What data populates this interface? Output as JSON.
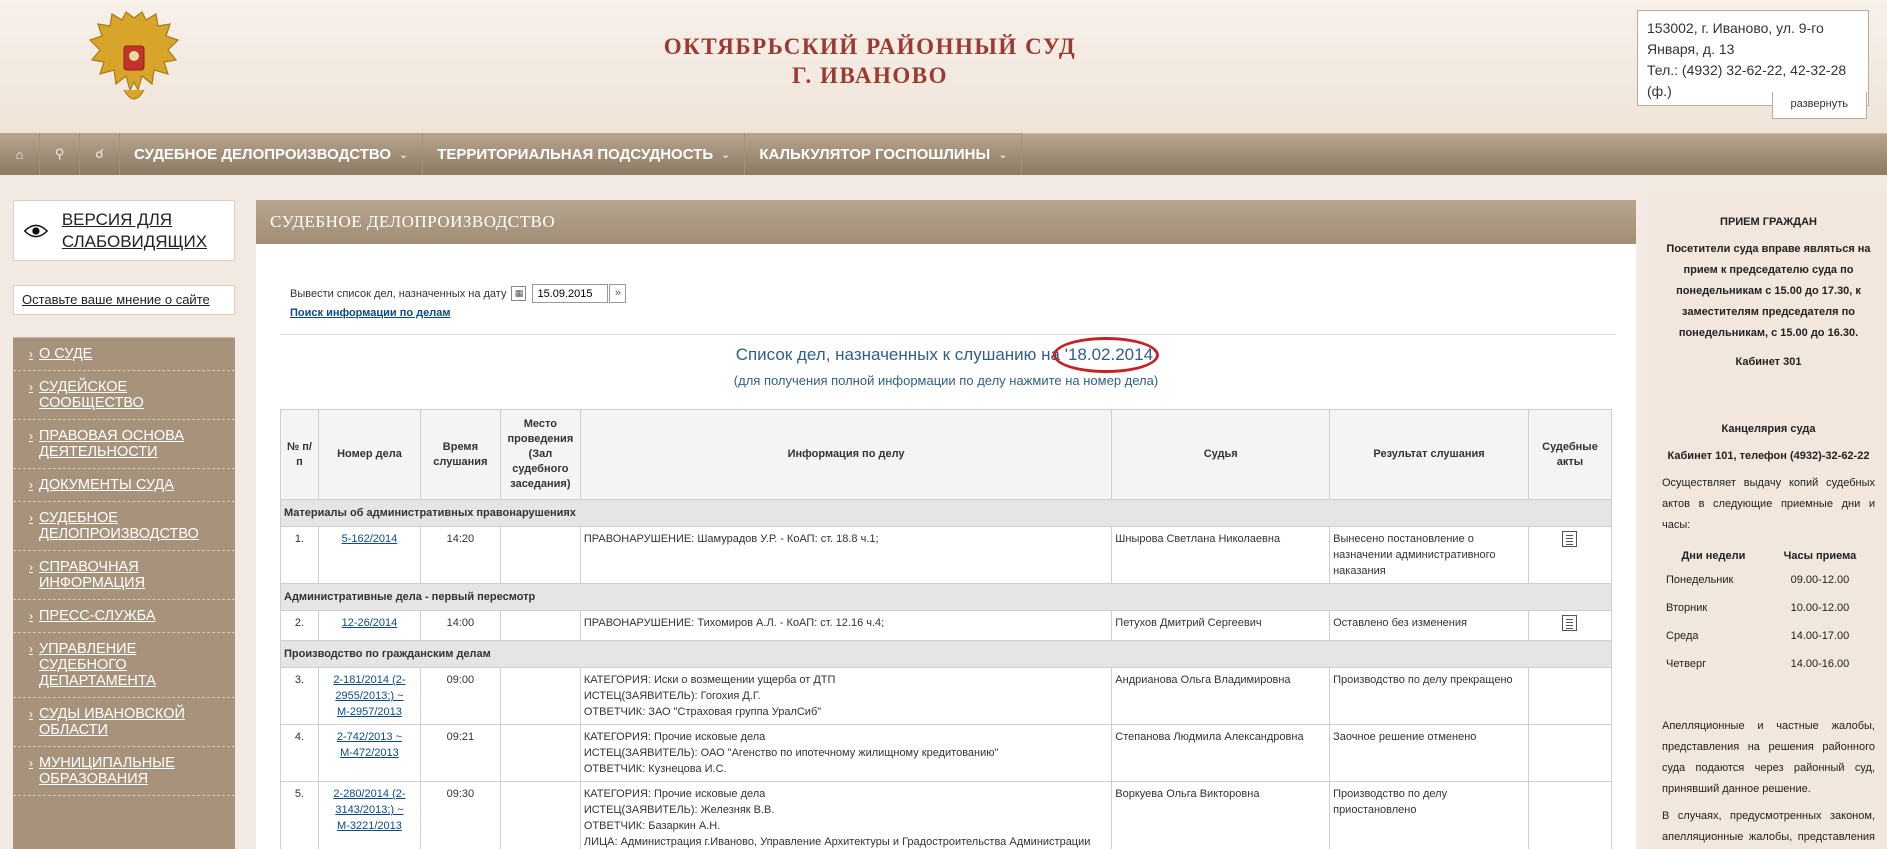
{
  "header": {
    "title_line1": "ОКТЯБРЬСКИЙ РАЙОННЫЙ СУД",
    "title_line2": "Г. ИВАНОВО",
    "address": "153002, г. Иваново, ул. 9-го Января, д. 13",
    "phone": "Тел.: (4932) 32-62-22, 42-32-28 (ф.)",
    "expand_label": "развернуть"
  },
  "nav": {
    "items": [
      {
        "label": "СУДЕБНОЕ ДЕЛОПРОИЗВОДСТВО"
      },
      {
        "label": "ТЕРРИТОРИАЛЬНАЯ ПОДСУДНОСТЬ"
      },
      {
        "label": "КАЛЬКУЛЯТОР ГОСПОШЛИНЫ"
      }
    ]
  },
  "left": {
    "vision_label": "ВЕРСИЯ ДЛЯ СЛАБОВИДЯЩИХ",
    "opinion_label": "Оставьте ваше мнение о сайте",
    "menu": [
      "О СУДЕ",
      "СУДЕЙСКОЕ СООБЩЕСТВО",
      "ПРАВОВАЯ ОСНОВА ДЕЯТЕЛЬНОСТИ",
      "ДОКУМЕНТЫ СУДА",
      "СУДЕБНОЕ ДЕЛОПРОИЗВОДСТВО",
      "СПРАВОЧНАЯ ИНФОРМАЦИЯ",
      "ПРЕСС-СЛУЖБА",
      "УПРАВЛЕНИЕ СУДЕБНОГО ДЕПАРТАМЕНТА",
      "СУДЫ ИВАНОВСКОЙ ОБЛАСТИ",
      "МУНИЦИПАЛЬНЫЕ ОБРАЗОВАНИЯ"
    ]
  },
  "main": {
    "section_title": "СУДЕБНОЕ ДЕЛОПРОИЗВОДСТВО",
    "date_label": "Вывести список дел, назначенных на дату",
    "date_value": "15.09.2015",
    "search_link": "Поиск информации по делам",
    "list_title": "Список дел, назначенных к слушанию на",
    "list_date": "'18.02.2014'",
    "list_subtitle": "(для получения полной информации по делу нажмите на номер дела)",
    "columns": [
      "№ п/п",
      "Номер дела",
      "Время слушания",
      "Место проведения (Зал судебного заседания)",
      "Информация по делу",
      "Судья",
      "Результат слушания",
      "Судебные акты"
    ],
    "groups": [
      {
        "name": "Материалы об административных правонарушениях",
        "rows": [
          {
            "n": "1.",
            "case": "5-162/2014",
            "time": "14:20",
            "place": "",
            "info": [
              "ПРАВОНАРУШЕНИЕ: Шамурадов У.Р. - КоАП: ст. 18.8 ч.1;"
            ],
            "judge": "Шнырова Светлана Николаевна",
            "result": "Вынесено постановление о назначении административного наказания",
            "acts": true
          }
        ]
      },
      {
        "name": "Административные дела - первый пересмотр",
        "rows": [
          {
            "n": "2.",
            "case": "12-26/2014",
            "time": "14:00",
            "place": "",
            "info": [
              "ПРАВОНАРУШЕНИЕ: Тихомиров А.Л. - КоАП: ст. 12.16 ч.4;"
            ],
            "judge": "Петухов Дмитрий Сергеевич",
            "result": "Оставлено без изменения",
            "acts": true
          }
        ]
      },
      {
        "name": "Производство по гражданским делам",
        "rows": [
          {
            "n": "3.",
            "case": "2-181/2014 (2-2955/2013;) ~ М-2957/2013",
            "time": "09:00",
            "place": "",
            "info": [
              "КАТЕГОРИЯ: Иски о возмещении ущерба от ДТП",
              "ИСТЕЦ(ЗАЯВИТЕЛЬ): Гогохия Д.Г.",
              "ОТВЕТЧИК: ЗАО \"Страховая группа УралСиб\""
            ],
            "judge": "Андрианова Ольга Владимировна",
            "result": "Производство по делу прекращено",
            "acts": false
          },
          {
            "n": "4.",
            "case": "2-742/2013 ~ М-472/2013",
            "time": "09:21",
            "place": "",
            "info": [
              "КАТЕГОРИЯ: Прочие исковые дела",
              "ИСТЕЦ(ЗАЯВИТЕЛЬ): ОАО \"Агенство по ипотечному жилищному кредитованию\"",
              "ОТВЕТЧИК: Кузнецова И.С."
            ],
            "judge": "Степанова Людмила Александровна",
            "result": "Заочное решение отменено",
            "acts": false
          },
          {
            "n": "5.",
            "case": "2-280/2014 (2-3143/2013;) ~ М-3221/2013",
            "time": "09:30",
            "place": "",
            "info": [
              "КАТЕГОРИЯ: Прочие исковые дела",
              "ИСТЕЦ(ЗАЯВИТЕЛЬ): Железняк В.В.",
              "ОТВЕТЧИК: Базаркин А.Н.",
              "ЛИЦА: Администрация г.Иваново, Управление Архитектуры и Градостроительства Администрации г.Иваново"
            ],
            "judge": "Воркуева Ольга Викторовна",
            "result": "Производство по делу приостановлено",
            "acts": false
          }
        ]
      }
    ]
  },
  "right": {
    "reception_title": "ПРИЕМ ГРАЖДАН",
    "reception_text": "Посетители суда вправе являться на прием к председателю суда по понедельникам с 15.00 до 17.30, к заместителям председателя по понедельникам, с 15.00 до 16.30.",
    "cabinet": "Кабинет 301",
    "office_title": "Канцелярия суда",
    "office_cabinet": "Кабинет 101, телефон (4932)-32-62-22",
    "office_text": "Осуществляет выдачу копий судебных актов в следующие приемные дни и часы:",
    "hours_head_day": "Дни недели",
    "hours_head_time": "Часы приема",
    "hours": [
      {
        "day": "Понедельник",
        "time": "09.00-12.00"
      },
      {
        "day": "Вторник",
        "time": "10.00-12.00"
      },
      {
        "day": "Среда",
        "time": "14.00-17.00"
      },
      {
        "day": "Четверг",
        "time": "14.00-16.00"
      }
    ],
    "appeal_text": "Апелляционные и частные жалобы, представления на решения районного суда подаются через районный суд, принявший данное решение.",
    "appeal_text2": "В случаях, предусмотренных законом, апелляционные жалобы, представления и приложения к ним письменные"
  },
  "colors": {
    "accent": "#9a3b33",
    "nav": "#a28d75",
    "link": "#0b4a8b",
    "highlight": "#c42224"
  }
}
